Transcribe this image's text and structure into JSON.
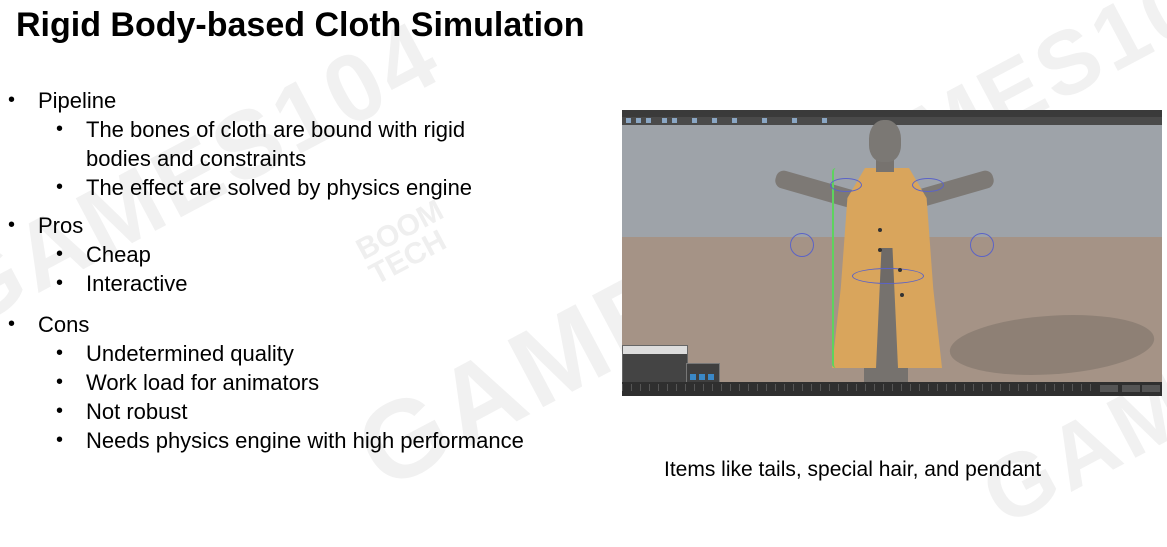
{
  "slide": {
    "title": "Rigid Body-based Cloth Simulation",
    "bullets": [
      {
        "text": "Pipeline",
        "children": [
          "The bones of cloth are bound with rigid",
          "bodies and constraints",
          "The effect are solved by physics engine"
        ]
      },
      {
        "text": "Pros",
        "children": [
          "Cheap",
          "Interactive"
        ]
      },
      {
        "text": "Cons",
        "children": [
          "Undetermined quality",
          "Work load for animators",
          "Not robust",
          "Needs physics engine with high performance"
        ]
      }
    ],
    "caption": "Items like tails, special hair, and pendant",
    "bullet_glyph": "•"
  },
  "watermarks": {
    "games": "GAMES104",
    "boom_line1": "BOOM",
    "boom_line2": "TECH"
  },
  "colors": {
    "coat": "#d9a55c",
    "viewport_sky": "#9ea3a9",
    "viewport_floor": "#a59386",
    "selection_outline": "#5ed35e",
    "rig_rings": "#5b63c7"
  }
}
